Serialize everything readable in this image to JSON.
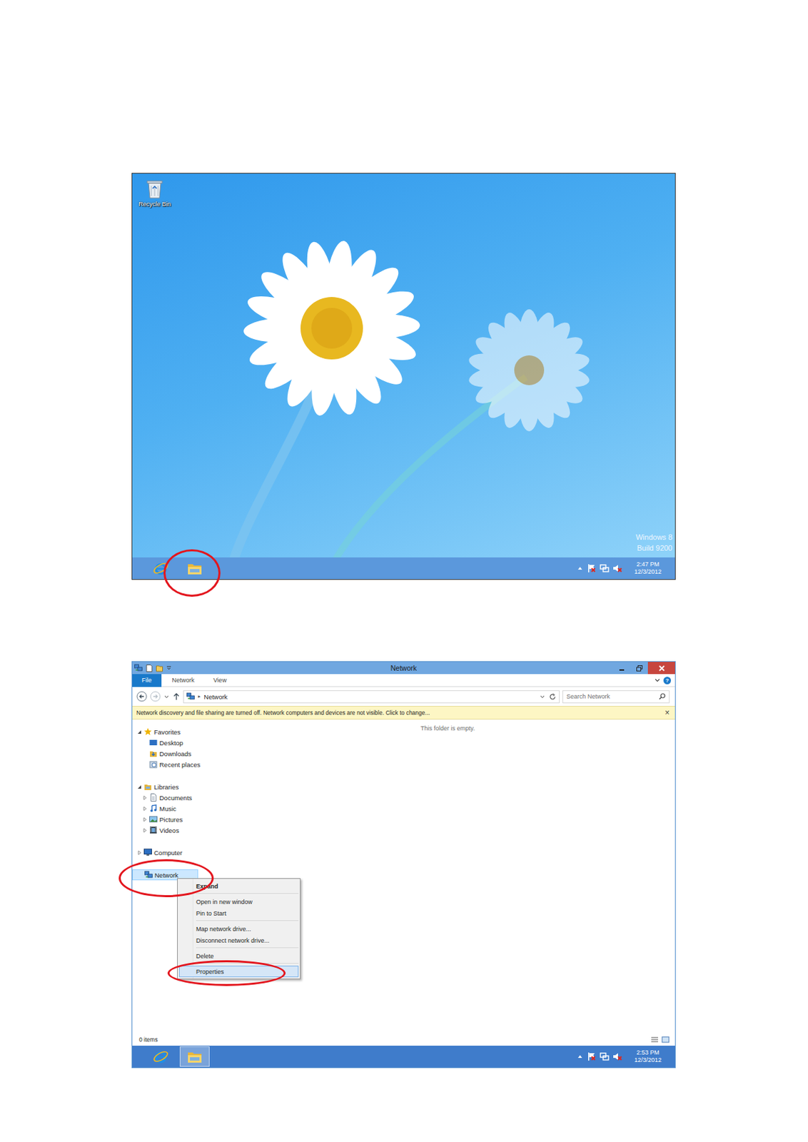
{
  "desktop": {
    "icons": [
      {
        "label": "Recycle Bin"
      }
    ],
    "watermark": [
      "Windows 8",
      "Build 9200"
    ],
    "taskbar": {
      "apps": [
        {
          "active": false
        },
        {
          "active": false
        }
      ],
      "time": "2:47 PM",
      "date": "12/3/2012"
    }
  },
  "explorer": {
    "window": {
      "title": "Network"
    },
    "ribbon_tabs": [
      {
        "label": "File",
        "selected": true
      },
      {
        "label": "Network",
        "selected": false
      },
      {
        "label": "View",
        "selected": false
      }
    ],
    "help": "?",
    "address": {
      "separator": "▸",
      "path": "Network"
    },
    "search": {
      "placeholder": "Search Network"
    },
    "infobar": {
      "text": "Network discovery and file sharing are turned off. Network computers and devices are not visible. Click to change...",
      "close": "×"
    },
    "empty_text": "This folder is empty.",
    "nav": [
      {
        "label": "Favorites",
        "kind": "group",
        "has_children": true,
        "expanded": true,
        "selected": false
      },
      {
        "label": "Desktop",
        "kind": "child",
        "has_children": false,
        "expanded": false,
        "selected": false
      },
      {
        "label": "Downloads",
        "kind": "child",
        "has_children": false,
        "expanded": false,
        "selected": false
      },
      {
        "label": "Recent places",
        "kind": "child",
        "has_children": false,
        "expanded": false,
        "selected": false
      },
      {
        "label": "Libraries",
        "kind": "group",
        "has_children": true,
        "expanded": true,
        "selected": false
      },
      {
        "label": "Documents",
        "kind": "child",
        "has_children": true,
        "expanded": false,
        "selected": false
      },
      {
        "label": "Music",
        "kind": "child",
        "has_children": true,
        "expanded": false,
        "selected": false
      },
      {
        "label": "Pictures",
        "kind": "child",
        "has_children": true,
        "expanded": false,
        "selected": false
      },
      {
        "label": "Videos",
        "kind": "child",
        "has_children": true,
        "expanded": false,
        "selected": false
      },
      {
        "label": "Computer",
        "kind": "group",
        "has_children": true,
        "expanded": false,
        "selected": false
      },
      {
        "label": "Network",
        "kind": "group",
        "has_children": false,
        "expanded": false,
        "selected": true
      }
    ],
    "context_menu": [
      {
        "label": "Expand",
        "kind": "item",
        "default": true,
        "selected": false
      },
      {
        "label": "",
        "kind": "separator",
        "default": false,
        "selected": false
      },
      {
        "label": "Open in new window",
        "kind": "item",
        "default": false,
        "selected": false
      },
      {
        "label": "Pin to Start",
        "kind": "item",
        "default": false,
        "selected": false
      },
      {
        "label": "",
        "kind": "separator",
        "default": false,
        "selected": false
      },
      {
        "label": "Map network drive...",
        "kind": "item",
        "default": false,
        "selected": false
      },
      {
        "label": "Disconnect network drive...",
        "kind": "item",
        "default": false,
        "selected": false
      },
      {
        "label": "",
        "kind": "separator",
        "default": false,
        "selected": false
      },
      {
        "label": "Delete",
        "kind": "item",
        "default": false,
        "selected": false
      },
      {
        "label": "",
        "kind": "separator",
        "default": false,
        "selected": false
      },
      {
        "label": "Properties",
        "kind": "item",
        "default": false,
        "selected": true
      }
    ],
    "status_bar": "0 items",
    "taskbar": {
      "apps": [
        {
          "active": false
        },
        {
          "active": true
        }
      ],
      "time": "2:53 PM",
      "date": "12/3/2012"
    }
  }
}
